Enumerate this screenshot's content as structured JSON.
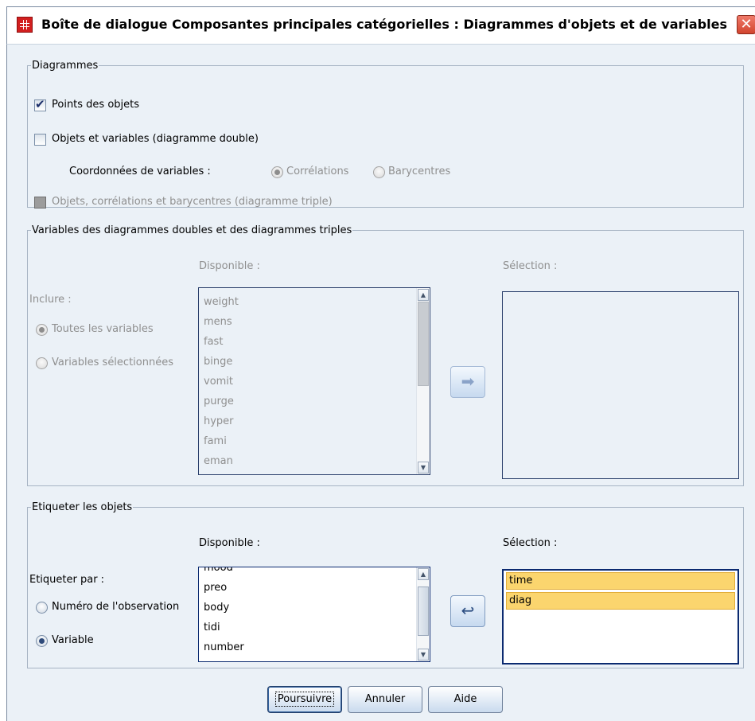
{
  "window": {
    "title": "Boîte de dialogue Composantes principales catégorielles : Diagrammes d'objets et de variables",
    "close_glyph": "✕"
  },
  "diagrammes": {
    "legend": "Diagrammes",
    "points_objets": {
      "label": "Points des objets",
      "checked": true
    },
    "objets_variables": {
      "label": "Objets et variables (diagramme double)",
      "checked": false
    },
    "coordonnees_label": "Coordonnées de variables :",
    "correlations": "Corrélations",
    "barycentres": "Barycentres",
    "triple": {
      "label": "Objets, corrélations et barycentres (diagramme triple)",
      "checked": false,
      "disabled": true
    }
  },
  "variables": {
    "legend": "Variables des diagrammes doubles et des diagrammes triples",
    "disponible_label": "Disponible :",
    "selection_label": "Sélection :",
    "inclure_label": "Inclure :",
    "toutes": "Toutes les variables",
    "selectionnees": "Variables sélectionnées",
    "available_items": [
      "weight",
      "mens",
      "fast",
      "binge",
      "vomit",
      "purge",
      "hyper",
      "fami",
      "eman"
    ],
    "selected_items": []
  },
  "etiqueter": {
    "legend": "Etiqueter les objets",
    "disponible_label": "Disponible :",
    "selection_label": "Sélection :",
    "etiqueter_par_label": "Etiqueter par :",
    "numero": "Numéro de l'observation",
    "variable": "Variable",
    "available_items": [
      "mood",
      "preo",
      "body",
      "tidi",
      "number"
    ],
    "selected_items": [
      "time",
      "diag"
    ]
  },
  "buttons": {
    "poursuivre": "Poursuivre",
    "annuler": "Annuler",
    "aide": "Aide"
  },
  "colors": {
    "dialog_bg": "#ebf1f7",
    "selection_highlight": "#fbd56e",
    "disabled_text": "#8f8f8f"
  }
}
